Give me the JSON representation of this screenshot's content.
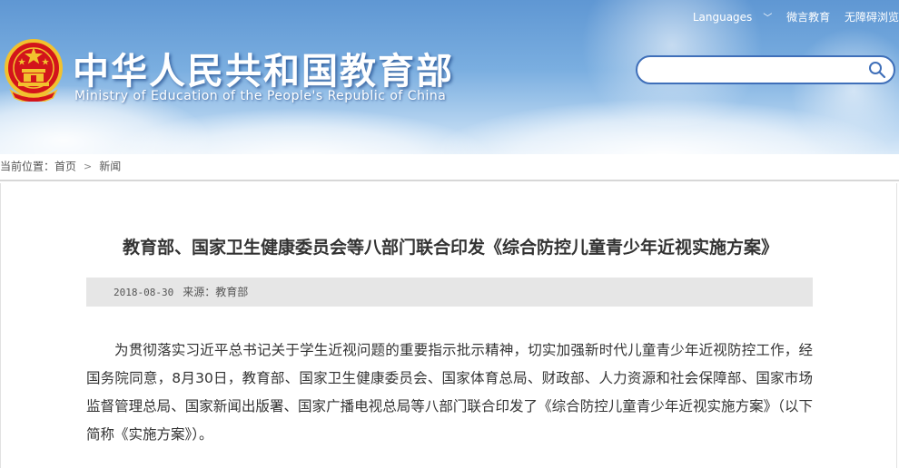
{
  "header": {
    "title_cn": "中华人民共和国教育部",
    "title_en": "Ministry of Education of the People's Republic of China",
    "links": {
      "languages": "Languages",
      "weibo": "微言教育",
      "accessibility": "无障碍浏览"
    },
    "search": {
      "placeholder": "",
      "value": ""
    },
    "icons": {
      "emblem": "national-emblem-icon",
      "language_chevron": "chevron-down-icon",
      "search": "search-icon"
    }
  },
  "breadcrumb": {
    "prefix": "当前位置：",
    "home": "首页",
    "separator_icon": "chevron-right-icon",
    "current": "新闻"
  },
  "article": {
    "title": "教育部、国家卫生健康委员会等八部门联合印发《综合防控儿童青少年近视实施方案》",
    "date": "2018-08-30",
    "source": "来源：教育部",
    "paragraph": "为贯彻落实习近平总书记关于学生近视问题的重要指示批示精神，切实加强新时代儿童青少年近视防控工作，经国务院同意，8月30日，教育部、国家卫生健康委员会、国家体育总局、财政部、人力资源和社会保障部、国家市场监督管理总局、国家新闻出版署、国家广播电视总局等八部门联合印发了《综合防控儿童青少年近视实施方案》（以下简称《实施方案》）。"
  },
  "colors": {
    "header_sky": "#6fa5dc",
    "search_border": "#3f6fb9",
    "meta_bar": "#e6e6e6",
    "emblem_red": "#d3141b",
    "emblem_gold": "#f2c12e"
  }
}
